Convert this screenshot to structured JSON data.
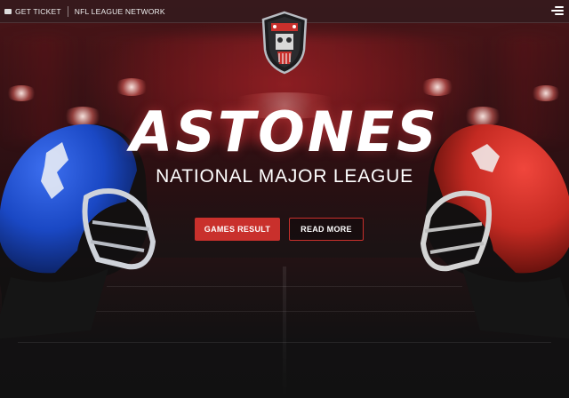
{
  "topbar": {
    "ticket_label": "GET TICKET",
    "network_label": "NFL LEAGUE NETWORK",
    "menu_icon": "hamburger-menu-icon"
  },
  "logo": {
    "icon": "skull-shield-logo"
  },
  "hero": {
    "title": "ASTONES",
    "subtitle": "NATIONAL MAJOR LEAGUE",
    "primary_button": "GAMES RESULT",
    "secondary_button": "READ MORE"
  },
  "colors": {
    "accent": "#c9302c",
    "background": "#121112",
    "helmet_left": "#1a48c4",
    "helmet_right": "#c42a22"
  }
}
